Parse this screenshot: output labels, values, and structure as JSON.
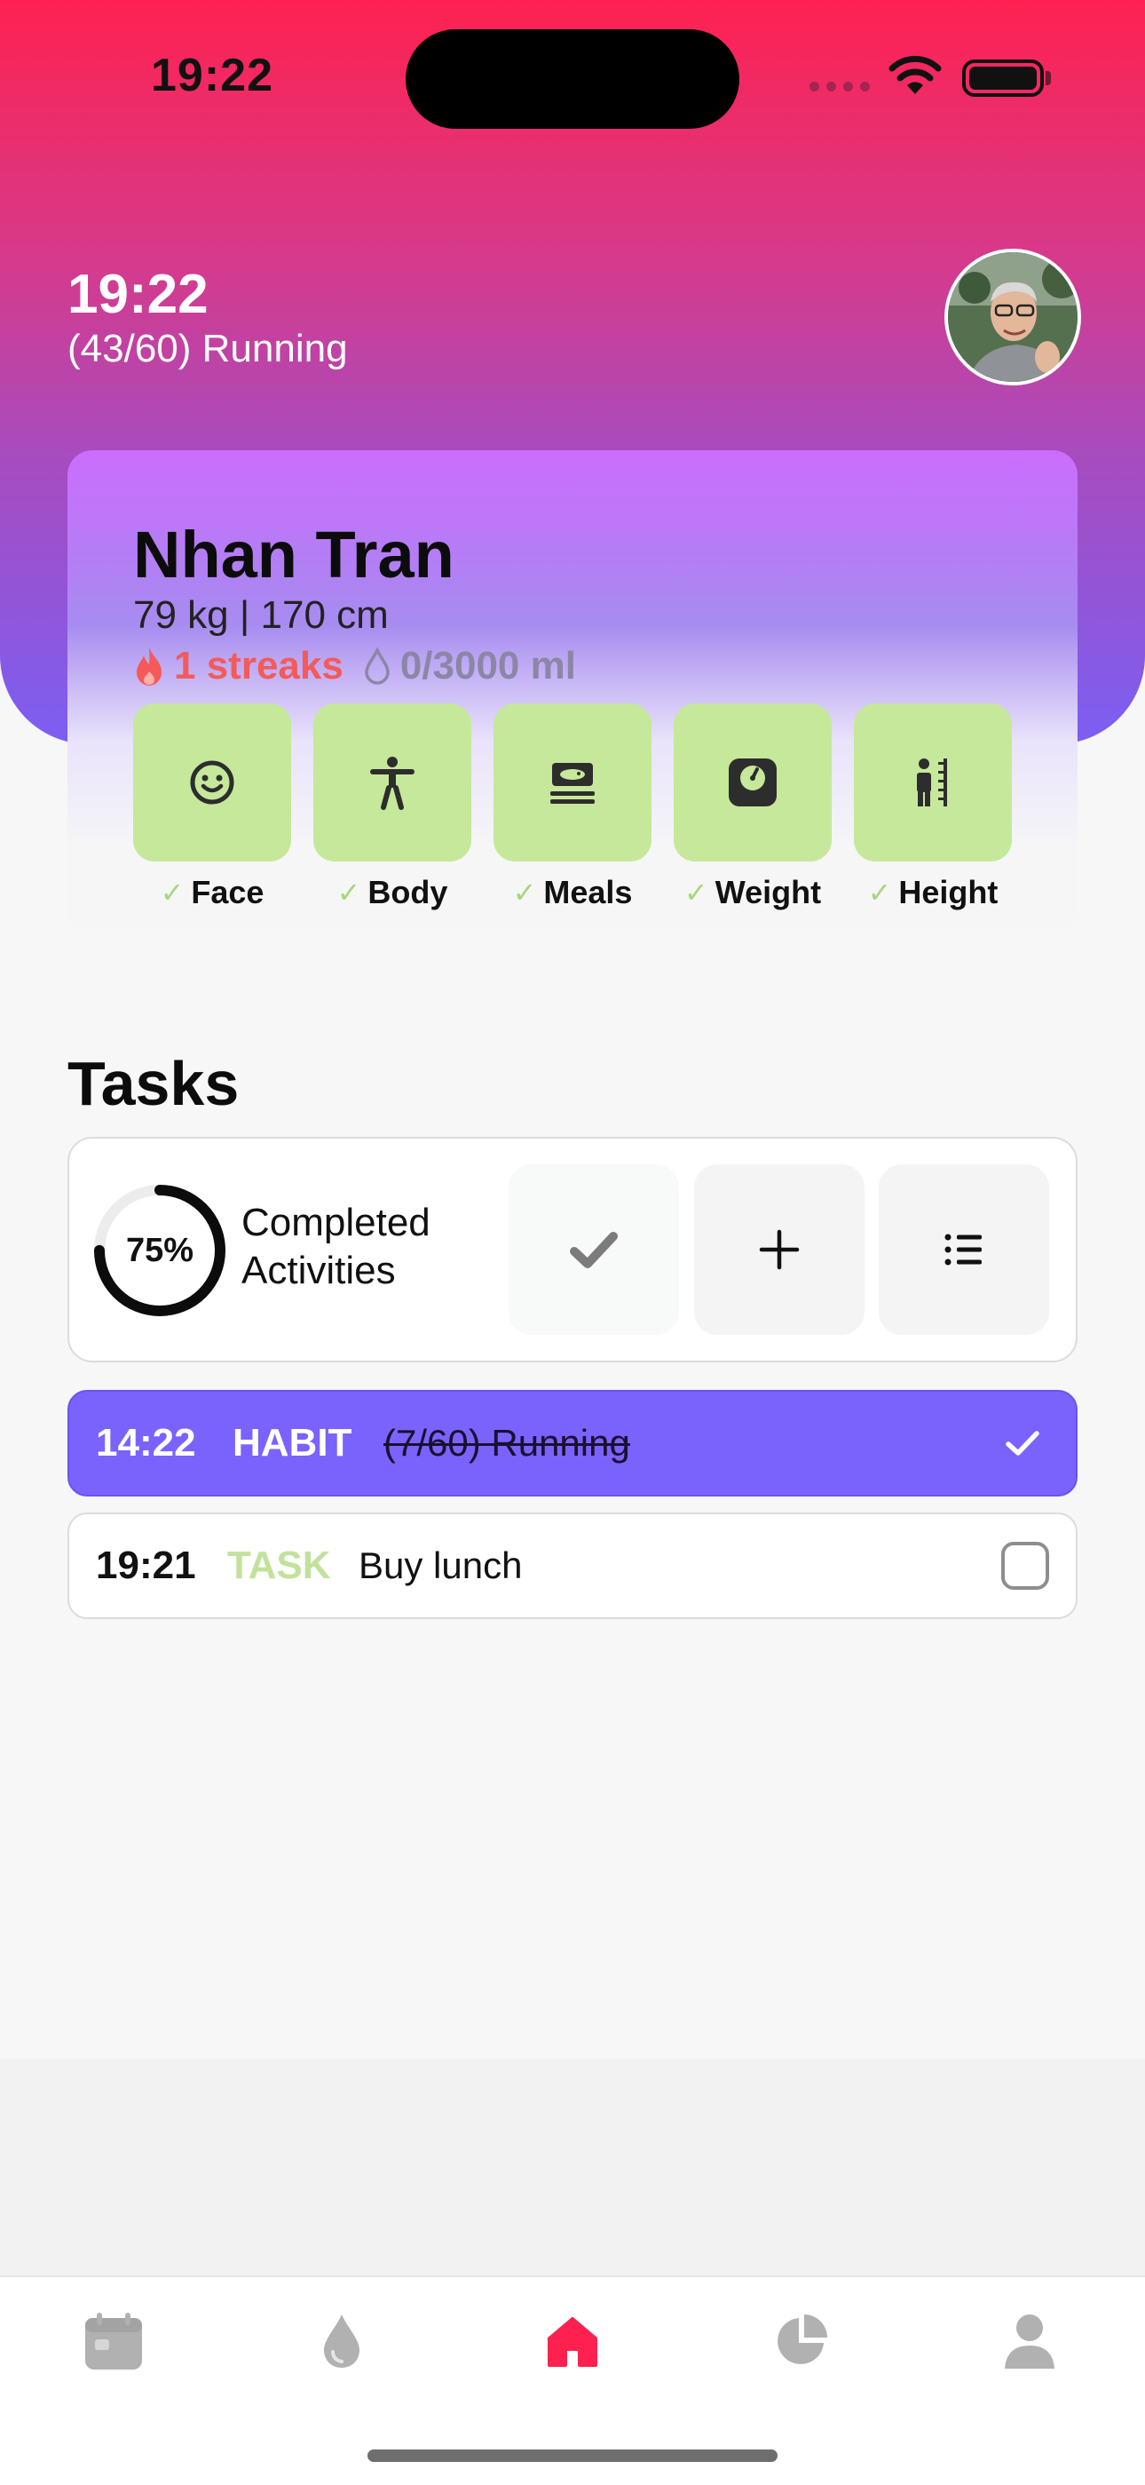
{
  "status_bar": {
    "time": "19:22"
  },
  "header": {
    "time": "19:22",
    "current_activity": "(43/60) Running",
    "avatar_icon": "user-photo-icon"
  },
  "profile": {
    "name": "Nhan Tran",
    "metrics": "79 kg | 170 cm",
    "streak_text": "1 streaks",
    "water_text": "0/3000 ml",
    "log_items": [
      {
        "label": "Face",
        "icon": "smile-icon",
        "checked": true
      },
      {
        "label": "Body",
        "icon": "body-icon",
        "checked": true
      },
      {
        "label": "Meals",
        "icon": "meal-icon",
        "checked": true
      },
      {
        "label": "Weight",
        "icon": "scale-icon",
        "checked": true
      },
      {
        "label": "Height",
        "icon": "height-icon",
        "checked": true
      }
    ]
  },
  "tasks": {
    "heading": "Tasks",
    "progress_percent": 75,
    "progress_label": "75%",
    "completed_label": "Completed Activities",
    "actions": [
      {
        "name": "complete-all",
        "icon": "check-icon"
      },
      {
        "name": "add-task",
        "icon": "plus-icon"
      },
      {
        "name": "list-view",
        "icon": "list-icon"
      }
    ],
    "items": [
      {
        "time": "14:22",
        "type": "HABIT",
        "title": "(7/60) Running",
        "done": true
      },
      {
        "time": "19:21",
        "type": "TASK",
        "title": "Buy lunch",
        "done": false
      }
    ]
  },
  "tab_bar": {
    "items": [
      {
        "name": "calendar",
        "icon": "calendar-icon",
        "active": false
      },
      {
        "name": "water",
        "icon": "water-drop-icon",
        "active": false
      },
      {
        "name": "home",
        "icon": "home-icon",
        "active": true
      },
      {
        "name": "stats",
        "icon": "pie-chart-icon",
        "active": false
      },
      {
        "name": "profile",
        "icon": "person-icon",
        "active": false
      }
    ]
  },
  "colors": {
    "accent": "#fe2150",
    "habit_row": "#7a63fd",
    "tile": "#c6e89a",
    "streak": "#f45a5a"
  }
}
